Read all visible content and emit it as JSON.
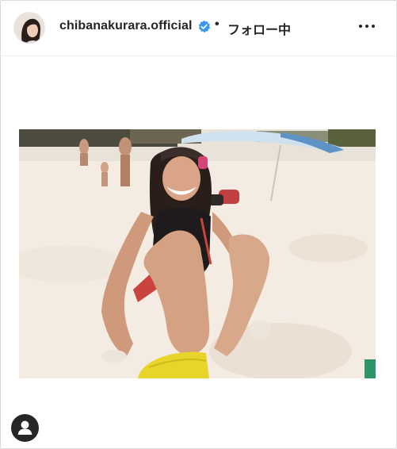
{
  "post_header": {
    "username": "chibanakurara.official",
    "separator": "•",
    "follow_status": "フォロー中",
    "more_icon": "more-horizontal-icon",
    "verified_icon": "verified-badge-icon",
    "verified_color": "#3897f0"
  },
  "post_media": {
    "type": "photo"
  },
  "footer": {
    "user_icon": "user-silhouette-icon"
  }
}
